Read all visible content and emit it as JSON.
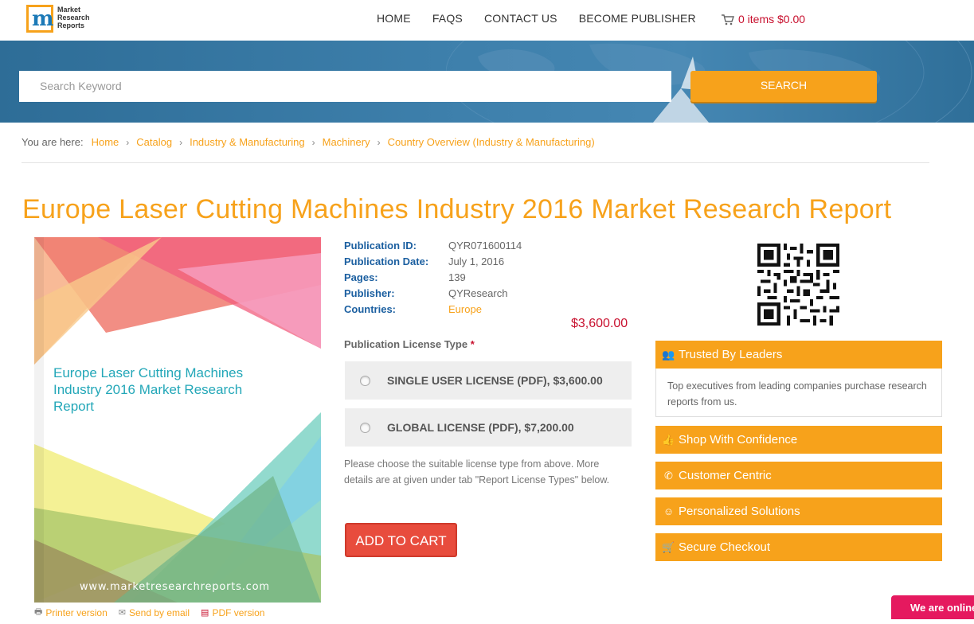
{
  "header": {
    "logo_lines": [
      "Market",
      "Research",
      "Reports"
    ],
    "nav": [
      "HOME",
      "FAQS",
      "CONTACT US",
      "BECOME PUBLISHER"
    ],
    "cart_text": "0 items $0.00"
  },
  "search": {
    "placeholder": "Search Keyword",
    "button": "SEARCH"
  },
  "breadcrumb": {
    "prefix": "You are here:",
    "items": [
      "Home",
      "Catalog",
      "Industry & Manufacturing",
      "Machinery",
      "Country Overview (Industry & Manufacturing)"
    ]
  },
  "page_title": "Europe Laser Cutting Machines Industry 2016 Market Research Report",
  "cover": {
    "title": "Europe Laser Cutting Machines Industry 2016 Market Research Report",
    "url": "www.marketresearchreports.com"
  },
  "cover_links": [
    "Printer version",
    "Send by email",
    "PDF version"
  ],
  "details": {
    "rows": [
      {
        "label": "Publication ID:",
        "value": "QYR071600114"
      },
      {
        "label": "Publication Date:",
        "value": "July 1, 2016"
      },
      {
        "label": "Pages:",
        "value": "139"
      },
      {
        "label": "Publisher:",
        "value": "QYResearch"
      },
      {
        "label": "Countries:",
        "value": "Europe"
      }
    ]
  },
  "price": "$3,600.00",
  "license": {
    "label": "Publication License Type",
    "required_mark": "*",
    "options": [
      "SINGLE USER LICENSE (PDF), $3,600.00",
      "GLOBAL LICENSE (PDF), $7,200.00"
    ],
    "note": "Please choose the suitable license type from above. More details are at given under tab \"Report License Types\" below."
  },
  "add_to_cart": "ADD TO CART",
  "panels": {
    "trusted_title": "Trusted By Leaders",
    "trusted_body": "Top executives from leading companies purchase research reports from us.",
    "shop": "Shop With Confidence",
    "customer": "Customer Centric",
    "personalized": "Personalized Solutions",
    "secure": "Secure Checkout"
  },
  "chat": "We are online",
  "colors": {
    "accent": "#f7a21b",
    "price_red": "#c8102e",
    "label_blue": "#1b5fa0",
    "button_red": "#e84c3d"
  }
}
